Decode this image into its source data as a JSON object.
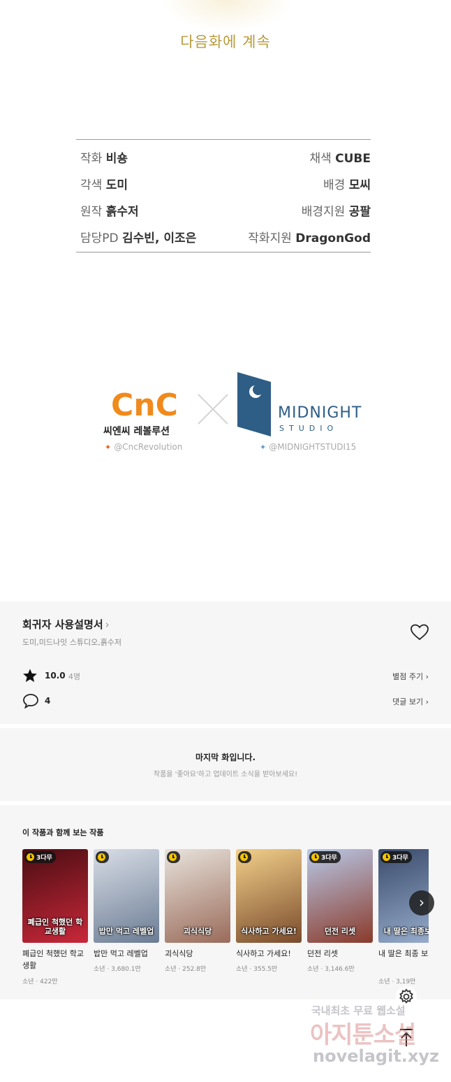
{
  "ending": {
    "next_text": "다음화에 계속"
  },
  "credits": [
    {
      "left_role": "작화",
      "left_name": "비숑",
      "right_role": "채색",
      "right_name": "CUBE"
    },
    {
      "left_role": "각색",
      "left_name": "도미",
      "right_role": "배경",
      "right_name": "모씨"
    },
    {
      "left_role": "원작",
      "left_name": "흙수저",
      "right_role": "배경지원",
      "right_name": "공팔"
    },
    {
      "left_role": "담당PD",
      "left_name": "김수빈, 이조은",
      "right_role": "작화지원",
      "right_name": "DragonGod"
    }
  ],
  "logos": {
    "cnc_mark": "CnC",
    "cnc_korean": "씨엔씨 레볼루션",
    "cnc_handle": "@CncRevolution",
    "midnight_name": "MIDNIGHT",
    "midnight_sub": "STUDIO",
    "midnight_handle": "@MIDNIGHTSTUDI15",
    "cnc_color": "#f08a1c",
    "midnight_color": "#2e5e86"
  },
  "info": {
    "title": "회귀자 사용설명서",
    "authors": "도미,미드나잇 스튜디오,흙수저",
    "rating": "10.0",
    "rating_count": "4명",
    "rate_button": "별점 주기",
    "comment_count": "4",
    "comment_button": "댓글 보기"
  },
  "last_episode": {
    "title": "마지막 화입니다.",
    "subtitle": "작품을 '좋아요'하고 업데이트 소식을 받아보세요!"
  },
  "recommendations": {
    "heading": "이 작품과 함께 보는 작품",
    "items": [
      {
        "title": "폐급인 척했던 학교생활",
        "meta": "소년 · 422만",
        "badge": "3다무",
        "cover_text": "폐급인 척했던 학교생활",
        "color_a": "#4a0d12",
        "color_b": "#c9283a"
      },
      {
        "title": "밥만 먹고 레벨업",
        "meta": "소년 · 3,680.1만",
        "badge": "",
        "cover_text": "밥만 먹고 레벨업",
        "color_a": "#d8dde6",
        "color_b": "#6b7c94"
      },
      {
        "title": "괴식식당",
        "meta": "소년 · 252.8만",
        "badge": "",
        "cover_text": "괴식식당",
        "color_a": "#e8e3dc",
        "color_b": "#9a6b5a"
      },
      {
        "title": "식사하고 가세요!",
        "meta": "소년 · 355.5만",
        "badge": "",
        "cover_text": "식사하고 가세요!",
        "color_a": "#f2d08a",
        "color_b": "#7a4b2c"
      },
      {
        "title": "던전 리셋",
        "meta": "소년 · 3,146.6만",
        "badge": "3다무",
        "cover_text": "던전 리셋",
        "color_a": "#b8c9e8",
        "color_b": "#8a3a2a"
      },
      {
        "title": "내 딸은 최종 보스",
        "meta": "소년 · 3,19만",
        "badge": "3다무",
        "cover_text": "내 딸은 최종보스",
        "color_a": "#3a4a6a",
        "color_b": "#9ab0d0"
      }
    ]
  },
  "watermark": {
    "line1": "국내최초 무료 웹소설",
    "line2": "아지툰소설",
    "line3": "novelagit.xyz"
  }
}
